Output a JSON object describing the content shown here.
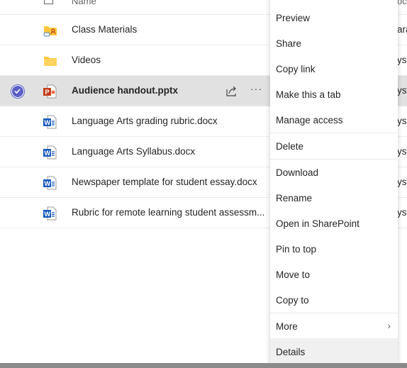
{
  "list": {
    "header": {
      "name": "Name",
      "right_fragment": "oc"
    },
    "rows": [
      {
        "name": "Class Materials",
        "icon": "shared-folder-icon",
        "right_fragment": "ara",
        "selected": false
      },
      {
        "name": "Videos",
        "icon": "folder-icon",
        "right_fragment": "yst",
        "selected": false
      },
      {
        "name": "Audience handout.pptx",
        "icon": "powerpoint-file-icon",
        "right_fragment": "yst",
        "selected": true
      },
      {
        "name": "Language Arts grading rubric.docx",
        "icon": "word-file-icon",
        "right_fragment": "yst",
        "selected": false
      },
      {
        "name": "Language Arts Syllabus.docx",
        "icon": "word-file-icon",
        "right_fragment": "yst",
        "selected": false
      },
      {
        "name": "Newspaper template for student essay.docx",
        "icon": "word-file-icon",
        "right_fragment": "yst",
        "selected": false
      },
      {
        "name": "Rubric for remote learning student assessm...",
        "icon": "word-file-icon",
        "right_fragment": "yst",
        "selected": false
      }
    ]
  },
  "menu": {
    "items": [
      "Preview",
      "Share",
      "Copy link",
      "Make this a tab",
      "Manage access",
      "Delete",
      "Download",
      "Rename",
      "Open in SharePoint",
      "Pin to top",
      "Move to",
      "Copy to",
      "More",
      "Details"
    ],
    "highlighted": "Details"
  },
  "colors": {
    "accent": "#5b5fc7",
    "selected_row": "#e1e1e1",
    "folder": "#ffc83d",
    "word": "#185abd",
    "powerpoint": "#c43e1c"
  }
}
